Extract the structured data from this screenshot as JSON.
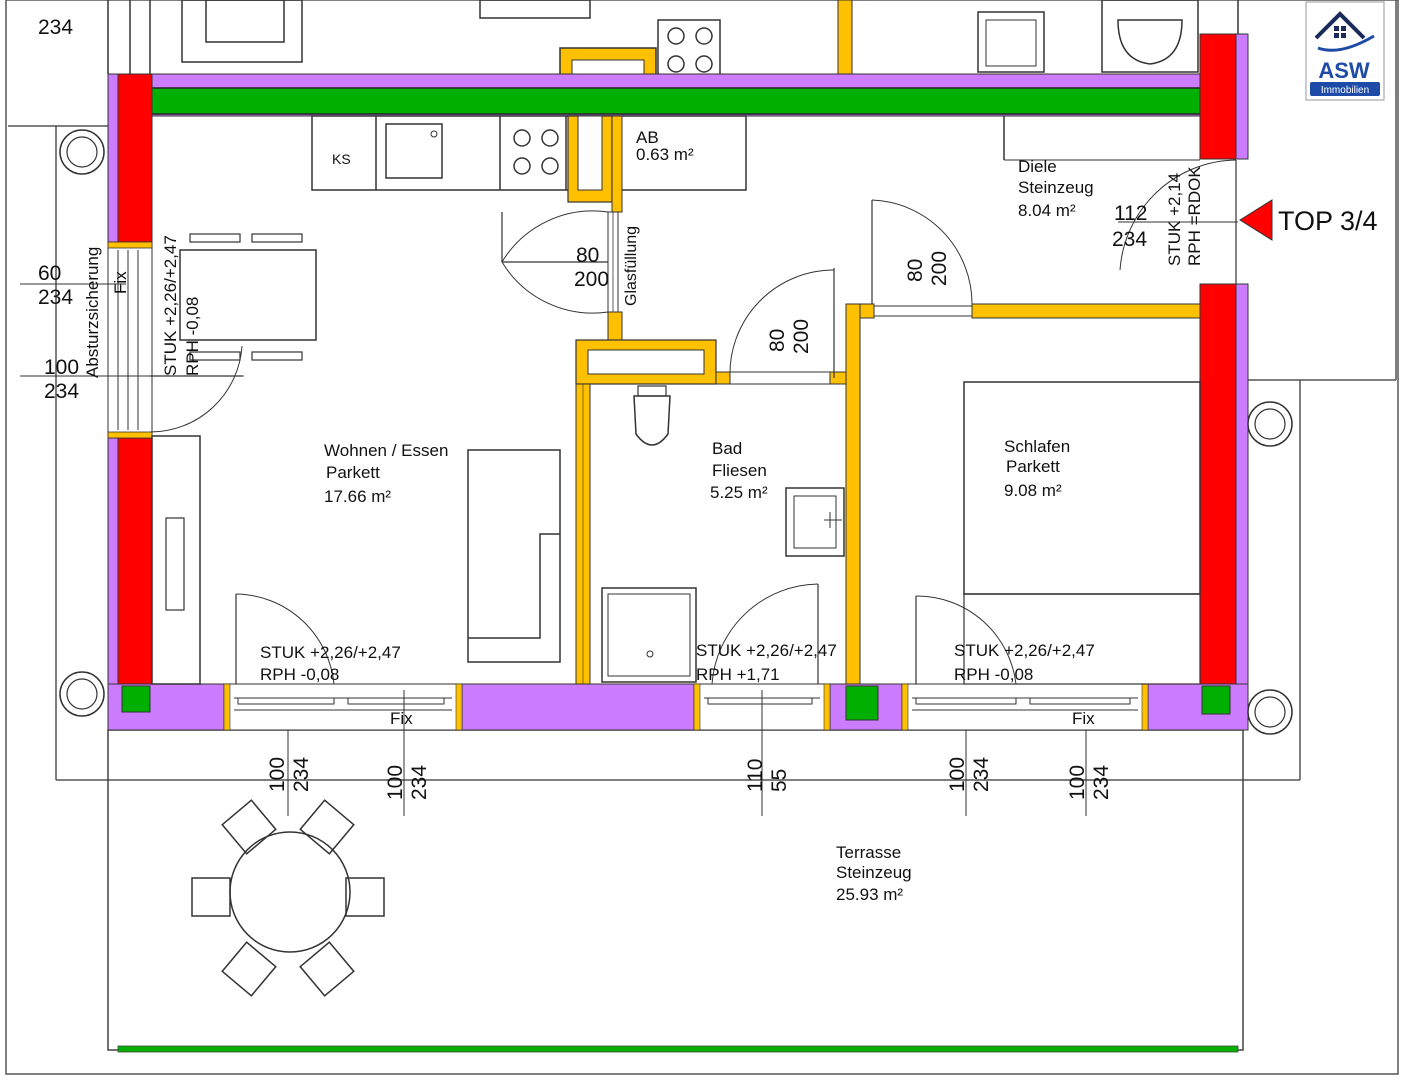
{
  "colors": {
    "load_wall": "#ff0000",
    "facade": "#cc7dff",
    "wall_light": "#ffc000",
    "green_beam": "#00b000",
    "logo_blue": "#1e4aa8",
    "marker": "#ff0000"
  },
  "logo": {
    "name": "ASW",
    "sub": "Immobilien"
  },
  "top_label": "TOP 3/4",
  "rooms": {
    "ab": {
      "name": "AB",
      "area": "0.63 m²"
    },
    "diele": {
      "name": "Diele",
      "floor": "Steinzeug",
      "area": "8.04 m²"
    },
    "wohnen": {
      "name": "Wohnen / Essen",
      "floor": "Parkett",
      "area": "17.66 m²"
    },
    "bad": {
      "name": "Bad",
      "floor": "Fliesen",
      "area": "5.25 m²"
    },
    "schlafen": {
      "name": "Schlafen",
      "floor": "Parkett",
      "area": "9.08 m²"
    },
    "terrasse": {
      "name": "Terrasse",
      "floor": "Steinzeug",
      "area": "25.93 m²"
    }
  },
  "appliances": {
    "ks": "KS"
  },
  "notes": {
    "glas": "Glasfüllung",
    "absturz": "Absturzsicherung",
    "fix_left": "Fix",
    "fix_bottom1": "Fix",
    "fix_bottom2": "Fix",
    "stuk_left": "STUK +2,26/+2,47",
    "rph_left": "RPH  -0,08",
    "stuk_wohnen": "STUK +2,26/+2,47",
    "rph_wohnen": "RPH   -0,08",
    "stuk_bad": "STUK +2,26/+2,47",
    "rph_bad": "RPH  +1,71",
    "stuk_schlaf": "STUK +2,26/+2,47",
    "rph_schlaf": "RPH   -0,08",
    "stuk_entry": "STUK +2,14",
    "rph_entry": "RPH =RDOK"
  },
  "dims": {
    "top_left": "234",
    "w60": "60",
    "h60": "234",
    "w100": "100",
    "h100": "234",
    "door_wohnen_w": "80",
    "door_wohnen_h": "200",
    "door_bad_w": "80",
    "door_bad_h": "200",
    "door_schlaf_w": "80",
    "door_schlaf_h": "200",
    "entry_w": "112",
    "entry_h": "234",
    "b1_w": "100",
    "b1_h": "234",
    "b2_w": "100",
    "b2_h": "234",
    "b3_w": "110",
    "b3_h": "55",
    "b4_w": "100",
    "b4_h": "234",
    "b5_w": "100",
    "b5_h": "234"
  }
}
